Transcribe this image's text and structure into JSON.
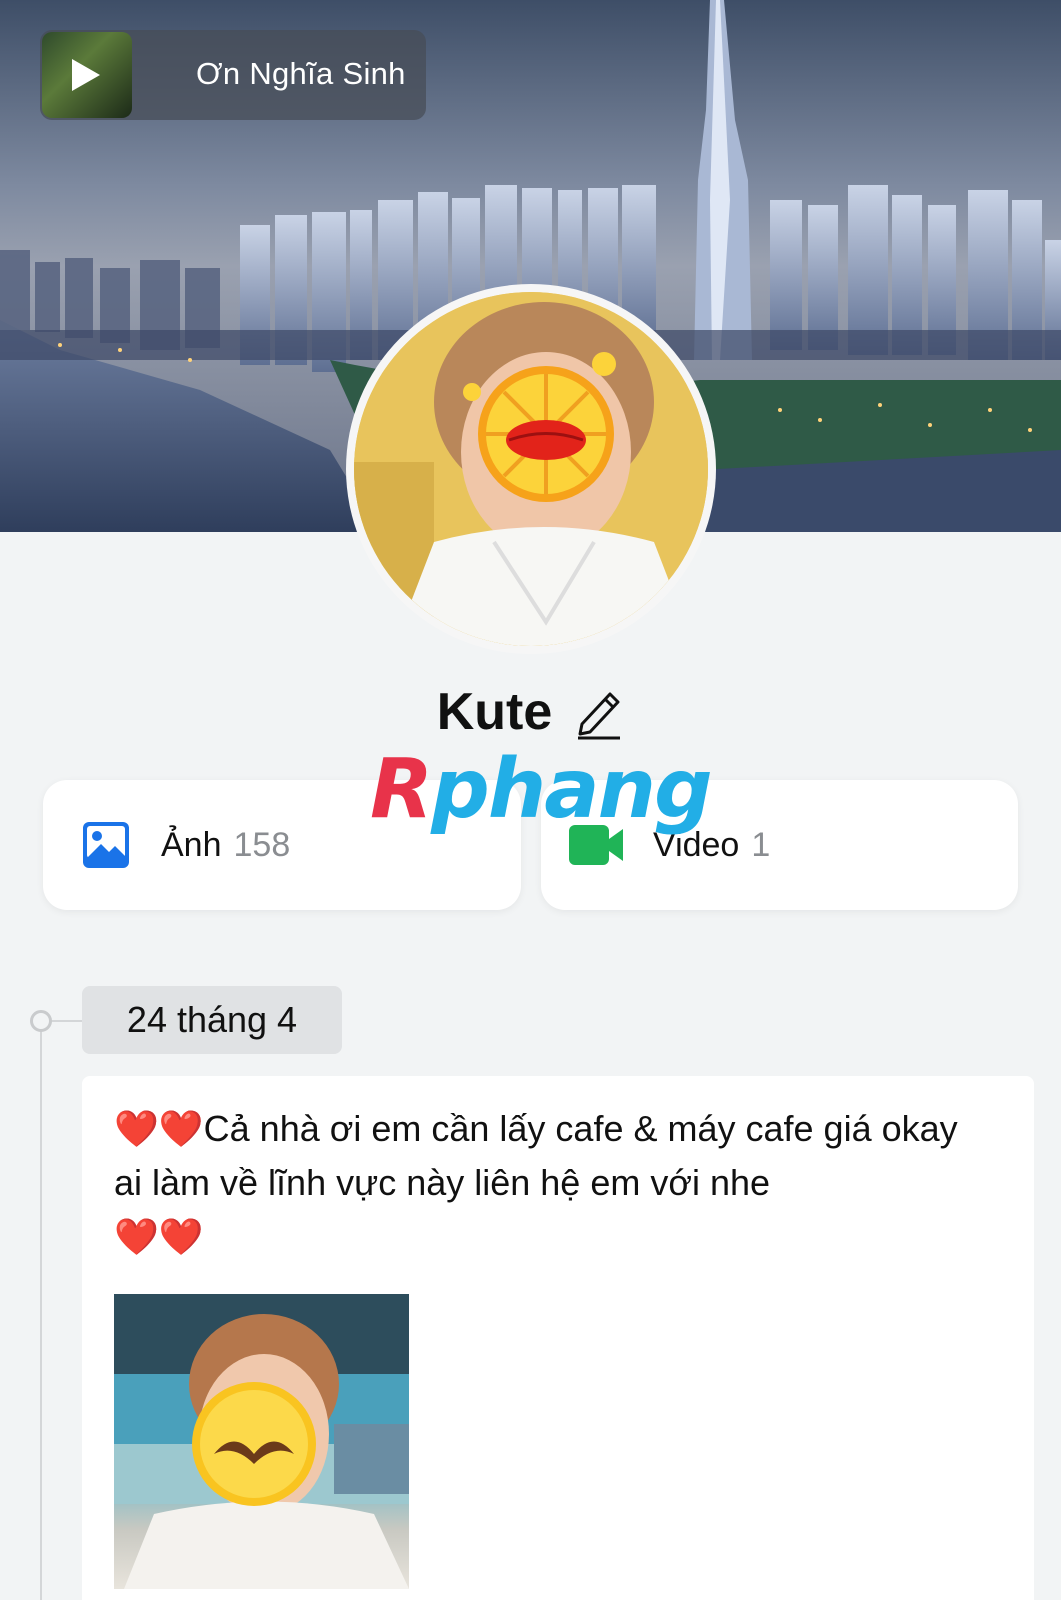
{
  "music": {
    "title": "Ơn Nghĩa Sinh",
    "thumb_icon": "play-icon"
  },
  "profile": {
    "name": "Kute",
    "edit_icon": "pencil-icon"
  },
  "watermark": {
    "first": "R",
    "rest": "phang"
  },
  "cards": {
    "photo": {
      "label": "Ảnh",
      "count": "158",
      "icon": "image-icon",
      "icon_color": "#1a73e8"
    },
    "video": {
      "label": "Video",
      "count": "1",
      "icon": "video-camera-icon",
      "icon_color": "#20b457"
    }
  },
  "timeline": {
    "date": "24 tháng 4"
  },
  "post": {
    "hearts_start": "❤️❤️",
    "text": "Cả nhà ơi em cần lấy cafe & máy cafe giá okay ai làm về lĩnh vực này liên hệ em với nhe",
    "hearts_end": "❤️❤️"
  }
}
